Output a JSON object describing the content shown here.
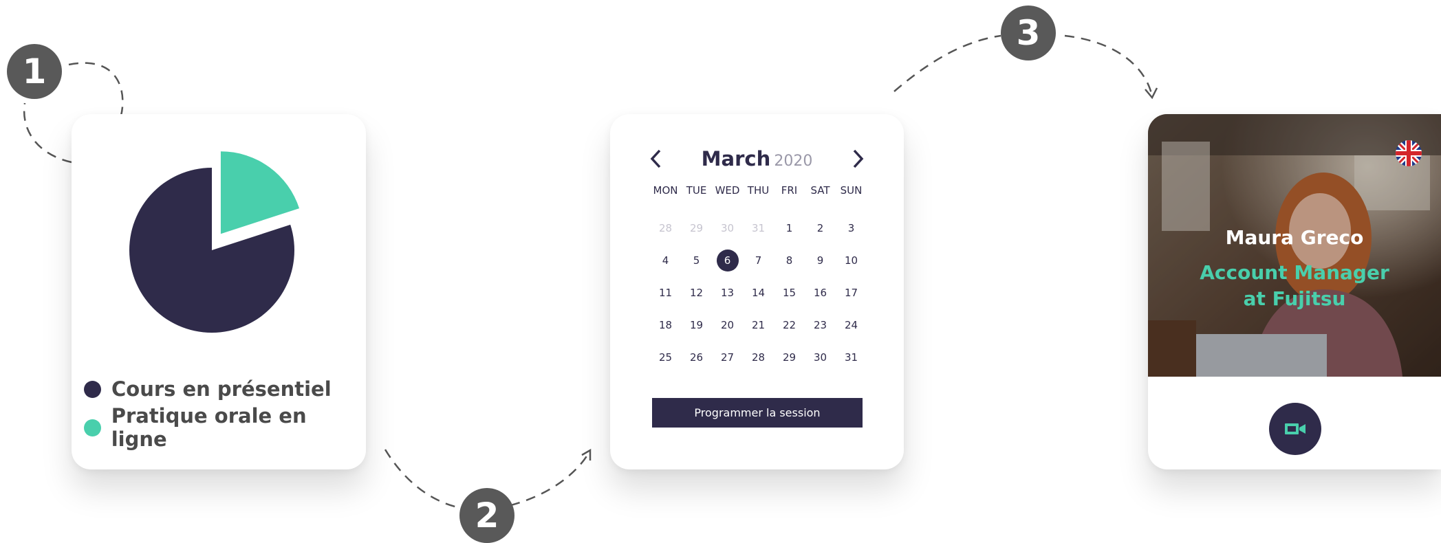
{
  "steps": [
    "1",
    "2",
    "3"
  ],
  "pie": {
    "slices": [
      {
        "label": "Cours en présentiel",
        "color": "#2f2b4a",
        "value": 80
      },
      {
        "label": "Pratique orale en ligne",
        "color": "#49cfac",
        "value": 20
      }
    ]
  },
  "calendar": {
    "month": "March",
    "year": "2020",
    "weekdays": [
      "MON",
      "TUE",
      "WED",
      "THU",
      "FRI",
      "SAT",
      "SUN"
    ],
    "days": [
      {
        "d": "28",
        "muted": true
      },
      {
        "d": "29",
        "muted": true
      },
      {
        "d": "30",
        "muted": true
      },
      {
        "d": "31",
        "muted": true
      },
      {
        "d": "1"
      },
      {
        "d": "2"
      },
      {
        "d": "3"
      },
      {
        "d": "4"
      },
      {
        "d": "5"
      },
      {
        "d": "6",
        "selected": true
      },
      {
        "d": "7"
      },
      {
        "d": "8"
      },
      {
        "d": "9"
      },
      {
        "d": "10"
      },
      {
        "d": "11"
      },
      {
        "d": "12"
      },
      {
        "d": "13"
      },
      {
        "d": "14"
      },
      {
        "d": "15"
      },
      {
        "d": "16"
      },
      {
        "d": "17"
      },
      {
        "d": "18"
      },
      {
        "d": "19"
      },
      {
        "d": "20"
      },
      {
        "d": "21"
      },
      {
        "d": "22"
      },
      {
        "d": "23"
      },
      {
        "d": "24"
      },
      {
        "d": "25"
      },
      {
        "d": "26"
      },
      {
        "d": "27"
      },
      {
        "d": "28"
      },
      {
        "d": "29"
      },
      {
        "d": "30"
      },
      {
        "d": "31"
      }
    ],
    "button_label": "Programmer la session",
    "prev_icon": "chevron-left-icon",
    "next_icon": "chevron-right-icon"
  },
  "profile": {
    "name": "Maura Greco",
    "role_line1": "Account Manager",
    "role_line2": "at Fujitsu",
    "flag_icon": "uk-flag-icon",
    "call_icon": "video-camera-icon",
    "accent": "#49cfac"
  },
  "colors": {
    "navy": "#2f2b4a",
    "teal": "#49cfac",
    "badge": "#595959"
  }
}
